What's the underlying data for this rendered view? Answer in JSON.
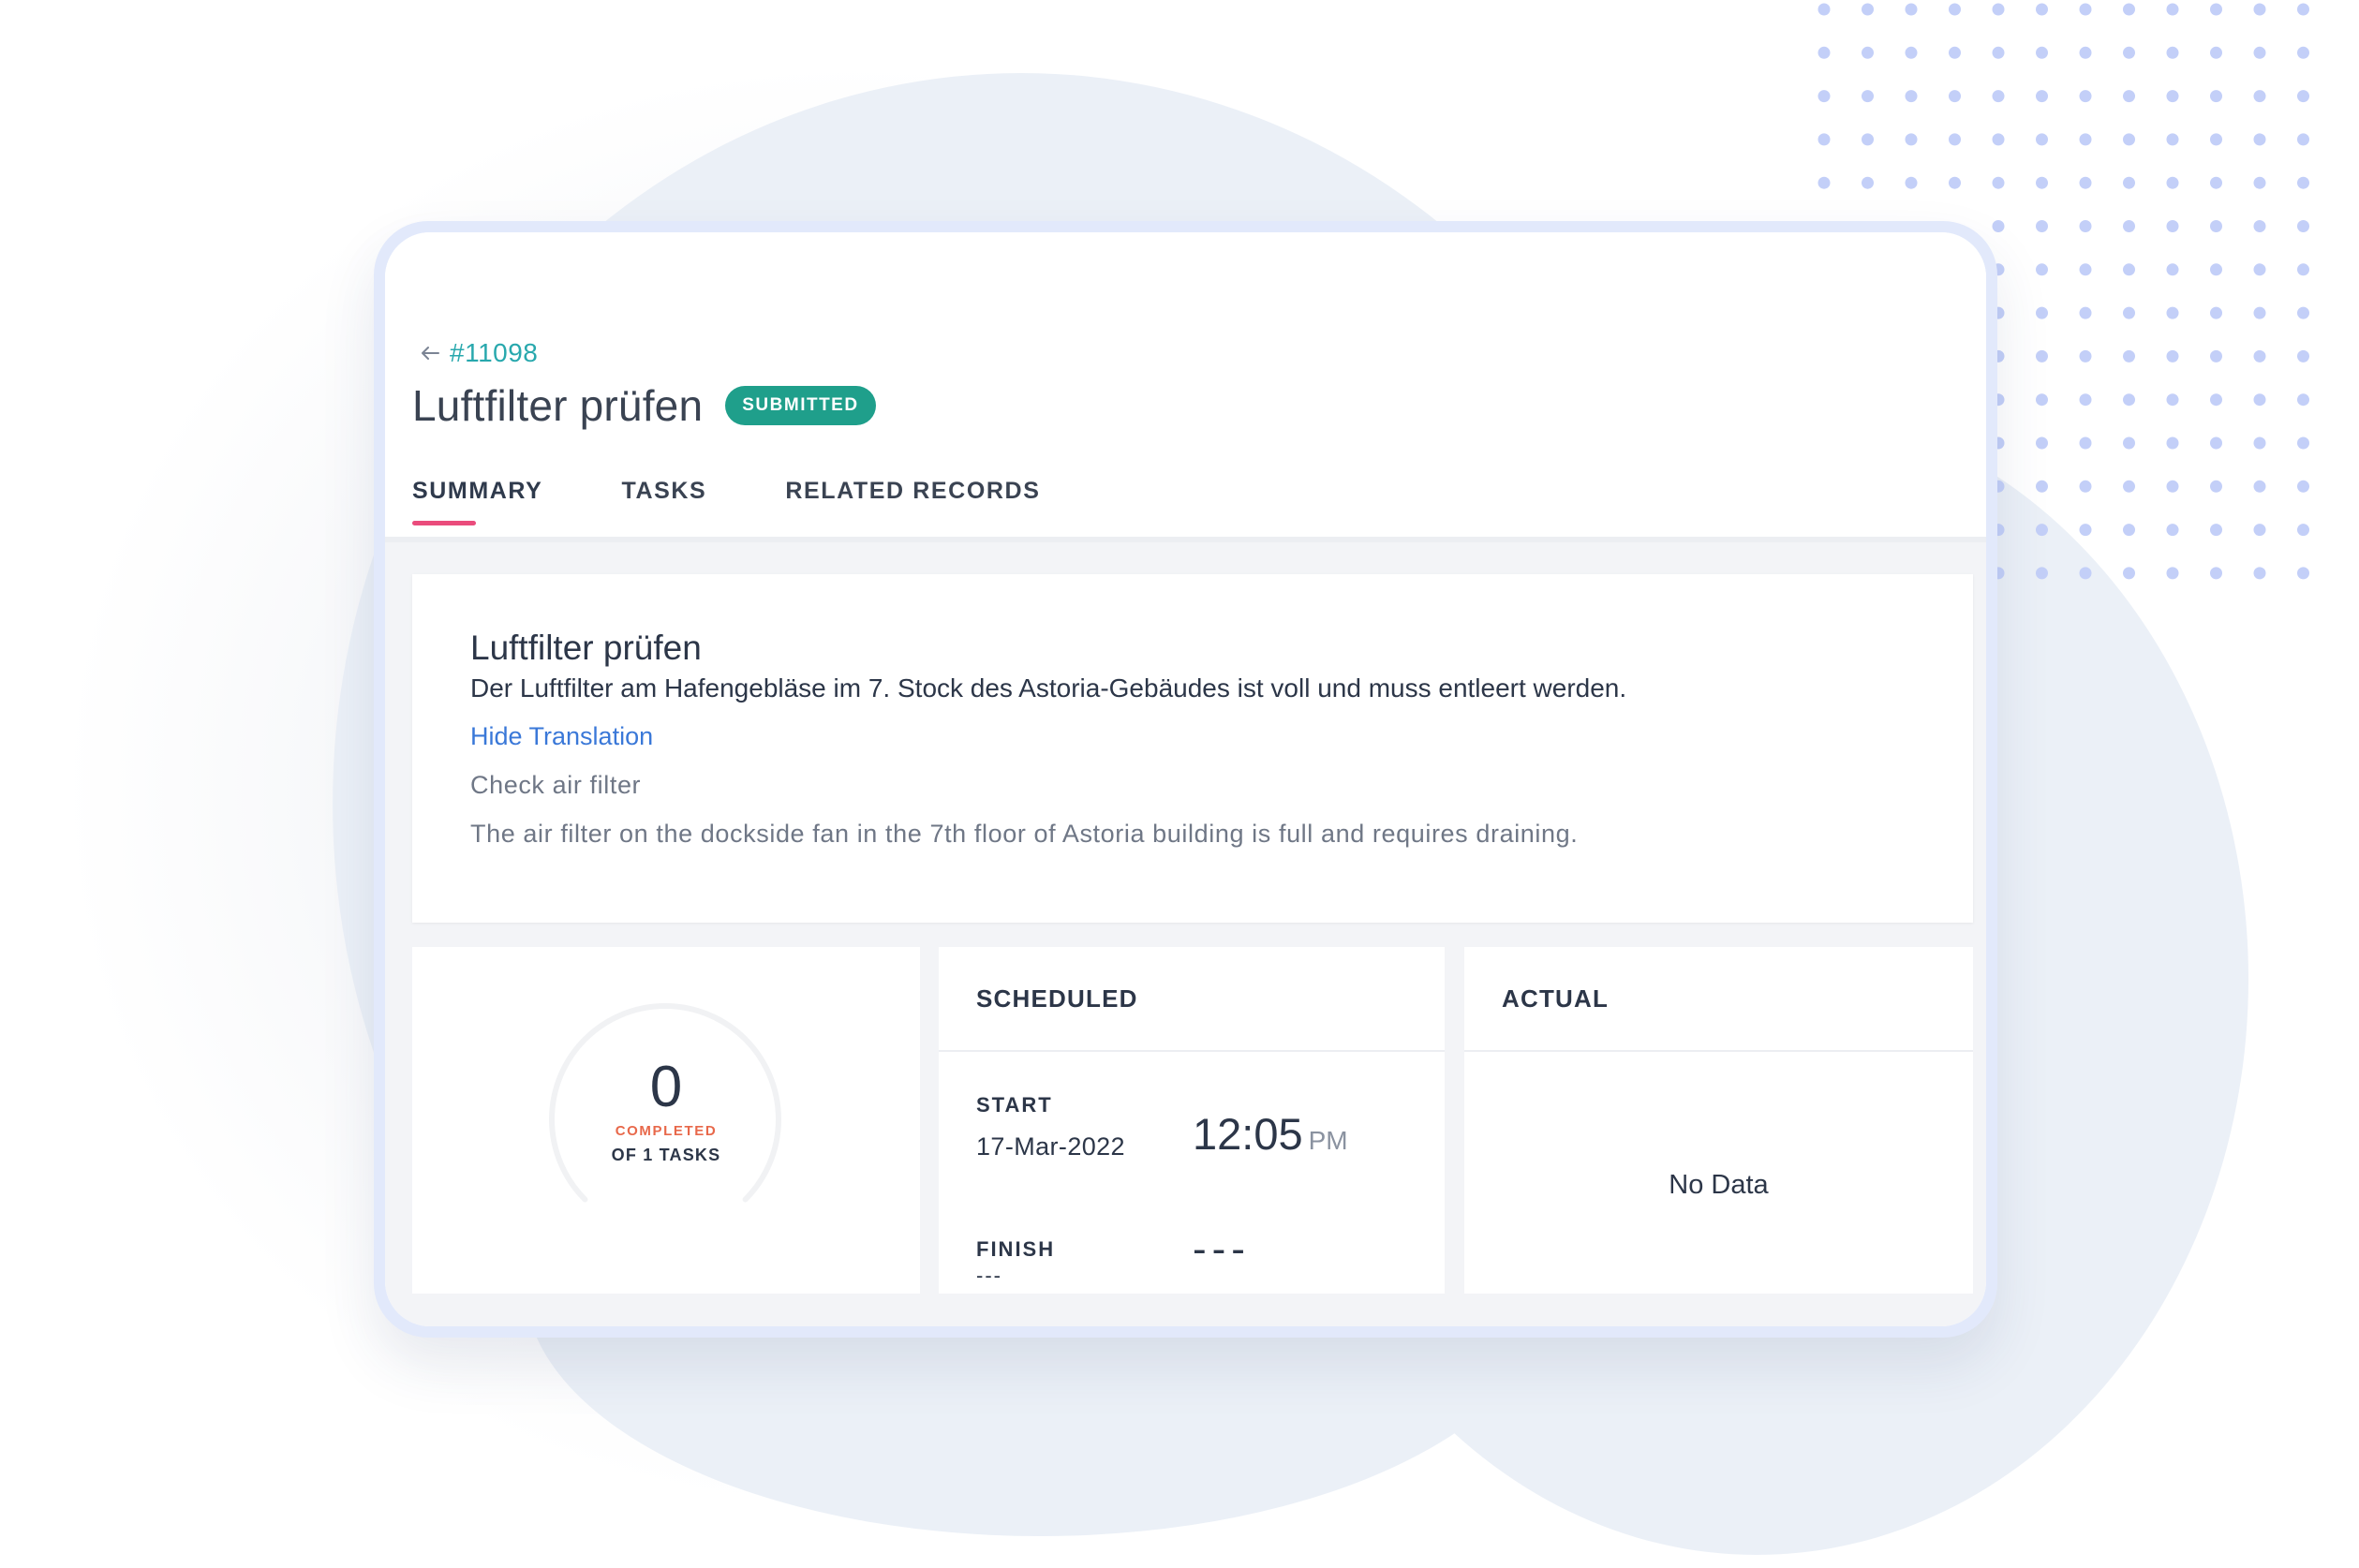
{
  "work_order": {
    "back_icon": "arrow-left-icon",
    "id": "#11098",
    "title": "Luftfilter prüfen",
    "status": "SUBMITTED",
    "status_color": "#1f9f8b"
  },
  "tabs": [
    {
      "label": "SUMMARY",
      "active": true
    },
    {
      "label": "TASKS",
      "active": false
    },
    {
      "label": "RELATED RECORDS",
      "active": false
    }
  ],
  "accent_color": "#ea4c7c",
  "description": {
    "title": "Luftfilter prüfen",
    "text": "Der Luftfilter am Hafengebläse im 7. Stock des Astoria-Gebäudes ist voll und muss entleert werden.",
    "toggle_label": "Hide Translation",
    "translated_title": "Check air filter",
    "translated_text": "The air filter on the dockside fan in the 7th floor of Astoria building is full and requires draining."
  },
  "progress": {
    "completed": "0",
    "completed_label": "COMPLETED",
    "of_label": "OF 1 TASKS",
    "fraction": 0
  },
  "scheduled": {
    "header": "SCHEDULED",
    "start_label": "START",
    "start_date": "17-Mar-2022",
    "start_time": "12:05",
    "start_ampm": "PM",
    "finish_label": "FINISH",
    "finish_date": "---",
    "finish_time": "---"
  },
  "actual": {
    "header": "ACTUAL",
    "empty_text": "No Data"
  }
}
